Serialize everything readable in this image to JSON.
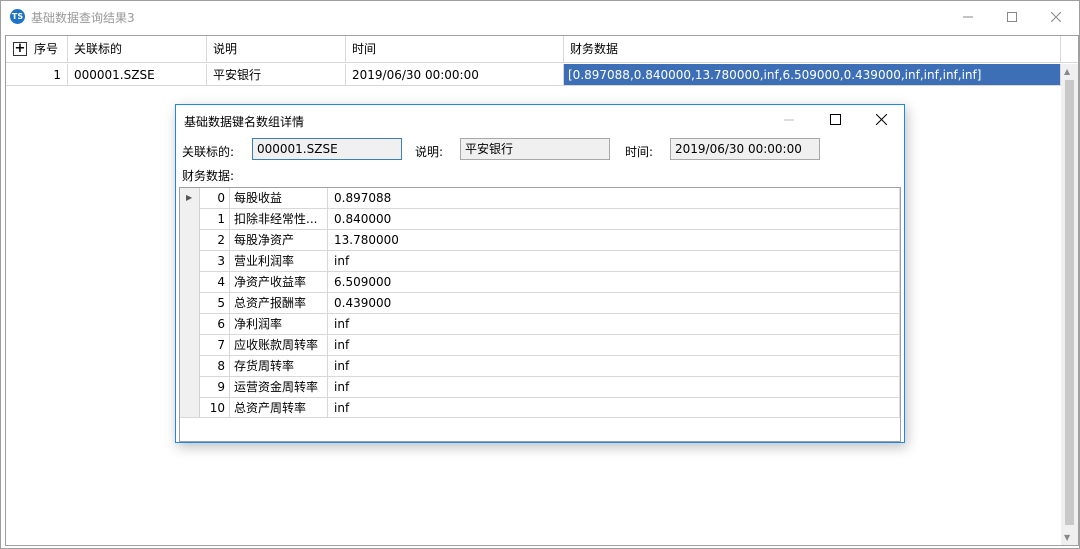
{
  "window": {
    "title": "基础数据查询结果3",
    "icon_label": "TS",
    "minimize_icon": "minimize-icon",
    "maximize_icon": "maximize-icon",
    "close_icon": "close-icon"
  },
  "main_grid": {
    "columns": [
      "序号",
      "关联标的",
      "说明",
      "时间",
      "财务数据"
    ],
    "rows": [
      {
        "index": "1",
        "symbol": "000001.SZSE",
        "desc": "平安银行",
        "time": "2019/06/30 00:00:00",
        "finance": "[0.897088,0.840000,13.780000,inf,6.509000,0.439000,inf,inf,inf,inf]"
      }
    ]
  },
  "dialog": {
    "title": "基础数据键名数组详情",
    "symbol_label": "关联标的:",
    "symbol_value": "000001.SZSE",
    "desc_label": "说明:",
    "desc_value": "平安银行",
    "time_label": "时间:",
    "time_value": "2019/06/30 00:00:00",
    "finance_label": "财务数据:",
    "items": [
      {
        "idx": "0",
        "name": "每股收益",
        "value": "0.897088"
      },
      {
        "idx": "1",
        "name": "扣除非经常性...",
        "value": "0.840000"
      },
      {
        "idx": "2",
        "name": "每股净资产",
        "value": "13.780000"
      },
      {
        "idx": "3",
        "name": "营业利润率",
        "value": "inf"
      },
      {
        "idx": "4",
        "name": "净资产收益率",
        "value": "6.509000"
      },
      {
        "idx": "5",
        "name": "总资产报酬率",
        "value": "0.439000"
      },
      {
        "idx": "6",
        "name": "净利润率",
        "value": "inf"
      },
      {
        "idx": "7",
        "name": "应收账款周转率",
        "value": "inf"
      },
      {
        "idx": "8",
        "name": "存货周转率",
        "value": "inf"
      },
      {
        "idx": "9",
        "name": "运营资金周转率",
        "value": "inf"
      },
      {
        "idx": "10",
        "name": "总资产周转率",
        "value": "inf"
      }
    ]
  },
  "colors": {
    "selection": "#3d6fb7",
    "dialog_border": "#1e88e5"
  }
}
